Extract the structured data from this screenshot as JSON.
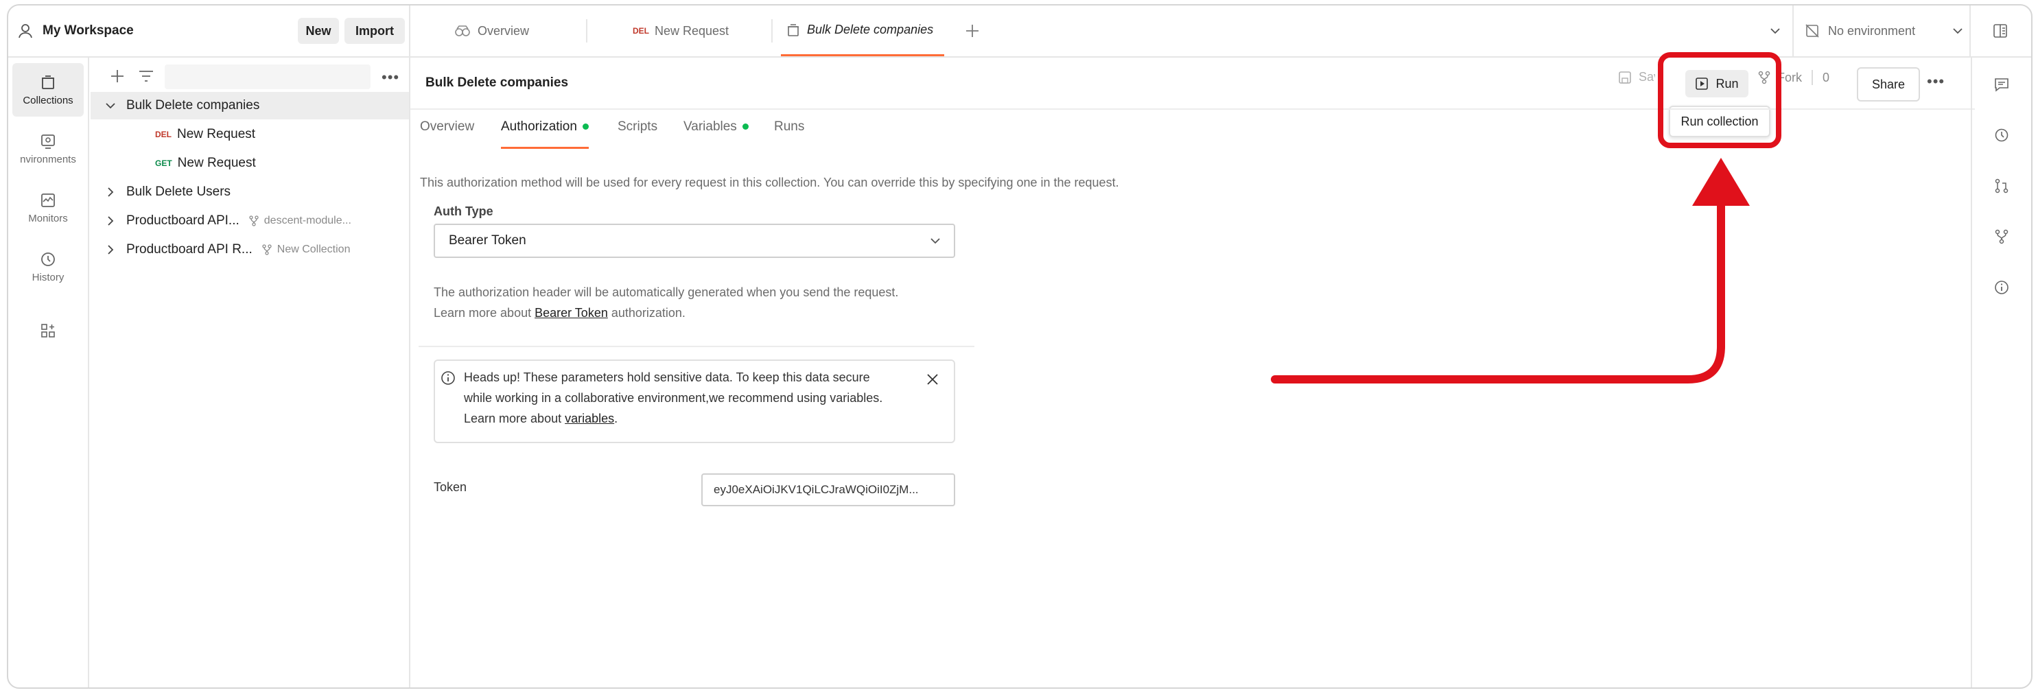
{
  "workspace": {
    "name": "My Workspace",
    "new_label": "New",
    "import_label": "Import"
  },
  "tabs": [
    {
      "label": "Overview"
    },
    {
      "method": "DEL",
      "label": "New Request"
    },
    {
      "label": "Bulk Delete companies"
    }
  ],
  "environment": {
    "label": "No environment"
  },
  "rail": [
    {
      "label": "Collections"
    },
    {
      "label": "nvironments"
    },
    {
      "label": "Monitors"
    },
    {
      "label": "History"
    }
  ],
  "tree": {
    "items": [
      {
        "label": "Bulk Delete companies"
      },
      {
        "method": "DEL",
        "label": "New Request"
      },
      {
        "method": "GET",
        "label": "New Request"
      },
      {
        "label": "Bulk Delete Users"
      },
      {
        "label": "Productboard API...",
        "fork": "descent-module..."
      },
      {
        "label": "Productboard API R...",
        "fork": "New Collection"
      }
    ]
  },
  "header": {
    "title": "Bulk Delete companies",
    "save_label": "Save",
    "run_label": "Run",
    "fork_label": "Fork",
    "fork_count": "0",
    "share_label": "Share",
    "run_dropdown_item": "Run collection"
  },
  "subtabs": [
    {
      "label": "Overview"
    },
    {
      "label": "Authorization"
    },
    {
      "label": "Scripts"
    },
    {
      "label": "Variables"
    },
    {
      "label": "Runs"
    }
  ],
  "auth": {
    "intro": "This authorization method will be used for every request in this collection. You can override this by specifying one in the request.",
    "type_label": "Auth Type",
    "type_value": "Bearer Token",
    "desc_line1": "The authorization header will be automatically generated when you send the request.",
    "desc_line2_prefix": "Learn more about",
    "desc_link": "Bearer Token",
    "desc_line2_suffix": "authorization.",
    "alert_line1": "Heads up! These parameters hold sensitive data. To keep this data secure",
    "alert_line2": "while working in a collaborative environment,we recommend using variables.",
    "alert_line3_prefix": "Learn more about",
    "alert_link": "variables",
    "alert_line3_suffix": ".",
    "token_label": "Token",
    "token_value": "eyJ0eXAiOiJKV1QiLCJraWQiOiI0ZjM..."
  },
  "colors": {
    "accent": "#ff6c37",
    "annotation": "#e0111b",
    "dot": "#0cbb52"
  }
}
